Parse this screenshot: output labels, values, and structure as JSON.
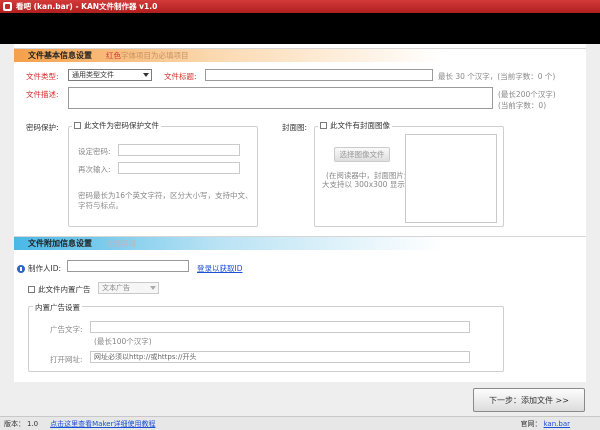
{
  "window": {
    "title": "看吧 (kan.bar) - KAN文件制作器 v1.0"
  },
  "basic": {
    "header": "文件基本信息设置",
    "note_red": "红色",
    "note_rest": "字体项目为必填项目",
    "type_label": "文件类型:",
    "type_value": "通用类型文件",
    "title_label": "文件标题:",
    "title_value": "",
    "title_hint": "最长 30 个汉字，(当前字数：0 个)",
    "desc_label": "文件描述:",
    "desc_value": "",
    "desc_hint1": "(最长200个汉字)",
    "desc_hint2": "(当前字数：0)",
    "password_label": "密码保护:",
    "password_checkbox": "此文件为密码保护文件",
    "set_password_label": "设定密码:",
    "confirm_password_label": "再次输入:",
    "password_hint1": "密码最长为16个英文字符，区分大小写，支持中文、",
    "password_hint2": "字符与标点。",
    "cover_label": "封面图:",
    "cover_checkbox": "此文件有封面图像",
    "cover_button": "选择图像文件",
    "cover_hint1": "(在阅读器中，封面图片最",
    "cover_hint2": "大支持以 300x300 显示)"
  },
  "extra": {
    "header": "文件附加信息设置",
    "note": "全部选填",
    "maker_label": "制作人ID:",
    "maker_value": "",
    "login_link": "登录以获取ID",
    "ad_checkbox": "此文件内置广告",
    "ad_type": "文本广告",
    "ad_group_title": "内置广告设置",
    "ad_text_label": "广告文字:",
    "ad_text_value": "",
    "ad_text_hint": "(最长100个汉字)",
    "ad_url_label": "打开网址:",
    "ad_url_value": "网址必须以http://或https://开头"
  },
  "next_button": "下一步：添加文件 >>",
  "status": {
    "version_label": "版本：",
    "version_value": "1.0",
    "tutorial_link": "点击这里查看Maker详细使用教程",
    "site_label": "官网：",
    "site_value": "kan.bar"
  },
  "colors": {
    "accent_red": "#d32f2f",
    "link_blue": "#1a4fd6",
    "section_orange": "#f5a04a",
    "section_blue": "#49b8e6"
  }
}
